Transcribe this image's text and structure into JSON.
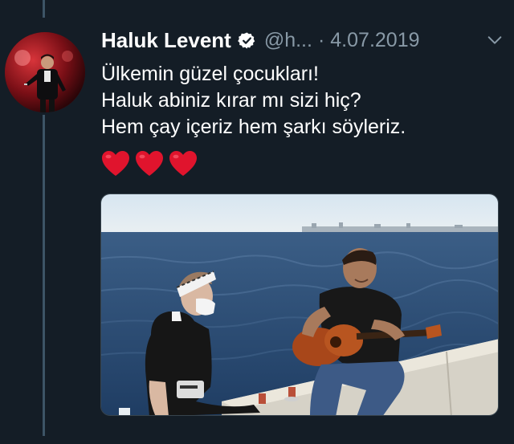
{
  "tweet": {
    "display_name": "Haluk Levent",
    "handle": "@h...",
    "separator": "·",
    "date": "4.07.2019",
    "lines": [
      "Ülkemin güzel çocukları!",
      "Haluk abiniz kırar mı sizi hiç?",
      "Hem çay içeriz hem şarkı söyleriz."
    ],
    "emoji": [
      "heart",
      "heart",
      "heart"
    ]
  },
  "icons": {
    "verified": "verified-badge-icon",
    "more": "chevron-down-icon",
    "heart": "red-heart-icon"
  },
  "colors": {
    "background": "#141d26",
    "text_primary": "#ffffff",
    "text_secondary": "#8899a6",
    "thread_line": "#3d5466",
    "heart": "#e0142d"
  }
}
